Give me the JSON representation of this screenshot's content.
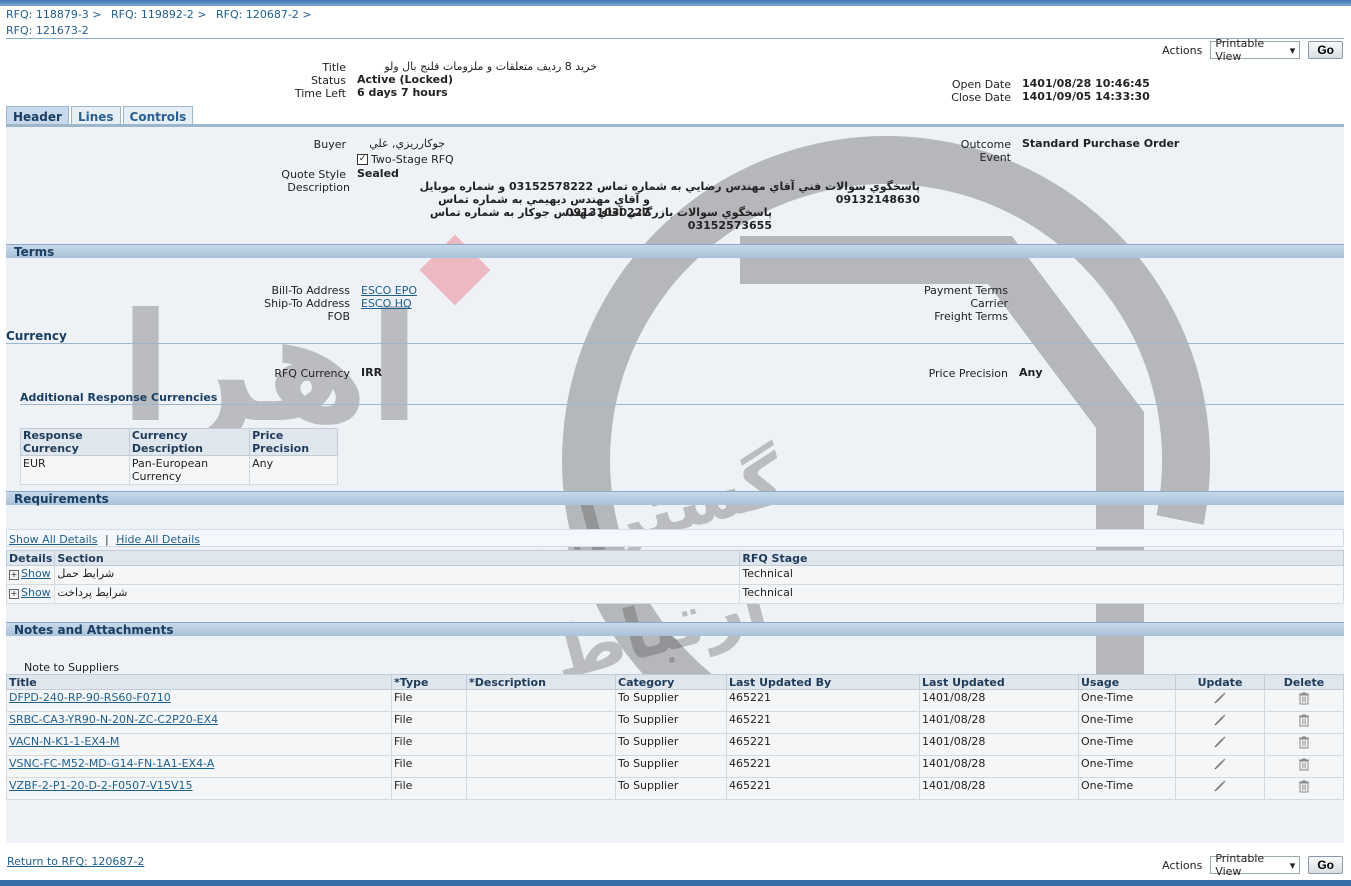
{
  "breadcrumbs": [
    "RFQ: 118879-3",
    "RFQ: 119892-2",
    "RFQ: 120687-2"
  ],
  "breadcrumb_sep": ">",
  "current_rfq": "RFQ: 121673-2",
  "actions": {
    "label": "Actions",
    "selected": "Printable View",
    "go": "Go"
  },
  "summary": {
    "title_label": "Title",
    "title_value": "خرید 8 ردیف متعلقات و ملزومات فلنج بال ولو",
    "status_label": "Status",
    "status_value": "Active (Locked)",
    "timeleft_label": "Time Left",
    "timeleft_value": "6 days 7 hours",
    "open_label": "Open Date",
    "open_value": "1401/08/28 10:46:45",
    "close_label": "Close Date",
    "close_value": "1401/09/05 14:33:30"
  },
  "tabs": [
    "Header",
    "Lines",
    "Controls"
  ],
  "header": {
    "buyer_label": "Buyer",
    "buyer_value": "جوكارريزي, علي",
    "two_stage_label": "Two-Stage RFQ",
    "quote_style_label": "Quote Style",
    "quote_style_value": "Sealed",
    "description_label": "Description",
    "description_lines": [
      "پاسخگوي سوالات فني آقاي مهندس رضايي به شماره تماس 03152578222 و شماره موبايل 09132148630",
      "و آقاي مهندس ديهيمي به شماره تماس 09131030227",
      "پاسخگوي سوالات بازرگاني آقاي مهندس جوكار به شماره تماس 03152573655"
    ],
    "outcome_label": "Outcome",
    "outcome_value": "Standard Purchase Order",
    "event_label": "Event"
  },
  "terms": {
    "title": "Terms",
    "bill_to_label": "Bill-To Address",
    "bill_to_value": "ESCO EPO",
    "ship_to_label": "Ship-To Address",
    "ship_to_value": "ESCO HQ",
    "fob_label": "FOB",
    "payment_label": "Payment Terms",
    "carrier_label": "Carrier",
    "freight_label": "Freight Terms"
  },
  "currency": {
    "title": "Currency",
    "rfq_currency_label": "RFQ Currency",
    "rfq_currency_value": "IRR",
    "price_precision_label": "Price Precision",
    "price_precision_value": "Any",
    "additional_title": "Additional Response Currencies",
    "columns": [
      "Response Currency",
      "Currency Description",
      "Price Precision"
    ],
    "rows": [
      [
        "EUR",
        "Pan-European Currency",
        "Any"
      ]
    ]
  },
  "requirements": {
    "title": "Requirements",
    "show_all": "Show All Details",
    "hide_all": "Hide All Details",
    "columns": [
      "Details",
      "Section",
      "RFQ Stage"
    ],
    "rows": [
      {
        "show": "Show",
        "section": "شرايط حمل",
        "stage": "Technical"
      },
      {
        "show": "Show",
        "section": "شرايط پرداخت",
        "stage": "Technical"
      }
    ]
  },
  "notes": {
    "title": "Notes and Attachments",
    "note_label": "Note to Suppliers",
    "columns": [
      "Title",
      "*Type",
      "*Description",
      "Category",
      "Last Updated By",
      "Last Updated",
      "Usage",
      "Update",
      "Delete"
    ],
    "rows": [
      {
        "title": "DFPD-240-RP-90-RS60-F0710",
        "type": "File",
        "desc": "",
        "category": "To Supplier",
        "by": "465221",
        "date": "1401/08/28",
        "usage": "One-Time"
      },
      {
        "title": "SRBC-CA3-YR90-N-20N-ZC-C2P20-EX4",
        "type": "File",
        "desc": "",
        "category": "To Supplier",
        "by": "465221",
        "date": "1401/08/28",
        "usage": "One-Time"
      },
      {
        "title": "VACN-N-K1-1-EX4-M",
        "type": "File",
        "desc": "",
        "category": "To Supplier",
        "by": "465221",
        "date": "1401/08/28",
        "usage": "One-Time"
      },
      {
        "title": "VSNC-FC-M52-MD-G14-FN-1A1-EX4-A",
        "type": "File",
        "desc": "",
        "category": "To Supplier",
        "by": "465221",
        "date": "1401/08/28",
        "usage": "One-Time"
      },
      {
        "title": "VZBF-2-P1-20-D-2-F0507-V15V15",
        "type": "File",
        "desc": "",
        "category": "To Supplier",
        "by": "465221",
        "date": "1401/08/28",
        "usage": "One-Time"
      }
    ]
  },
  "return_link": "Return to RFQ: 120687-2",
  "watermark_text": [
    "اهرا",
    "گستران",
    "ارتباط"
  ]
}
